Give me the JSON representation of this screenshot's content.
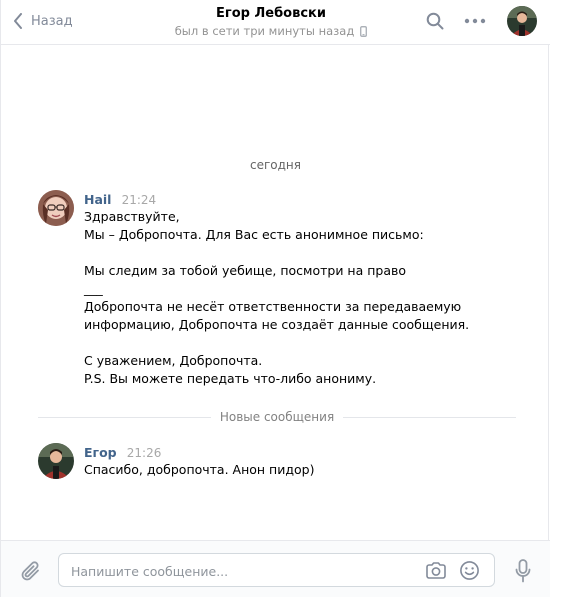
{
  "header": {
    "back_label": "Назад",
    "title": "Егор Лебовски",
    "status": "был в сети три минуты назад"
  },
  "chat": {
    "date_label": "сегодня",
    "new_messages_label": "Новые сообщения",
    "messages": [
      {
        "author": "Hail",
        "time": "21:24",
        "lines": [
          "Здравствуйте,",
          "Мы – Добропочта. Для Вас есть анонимное письмо:",
          "",
          "Мы следим за тобой уебище, посмотри на право",
          "___",
          "Добропочта не несёт ответственности за передаваемую",
          "информацию, Добропочта не создаёт данные сообщения.",
          "",
          "С уважением, Добропочта.",
          "P.S. Вы можете передать что-либо анониму."
        ]
      },
      {
        "author": "Егор",
        "time": "21:26",
        "lines": [
          "Спасибо, добропочта. Анон пидор)"
        ]
      }
    ]
  },
  "composer": {
    "placeholder": "Напишите сообщение...",
    "value": ""
  },
  "colors": {
    "accent": "#42648b",
    "icon": "#828a99",
    "border": "#e7e8ec"
  }
}
